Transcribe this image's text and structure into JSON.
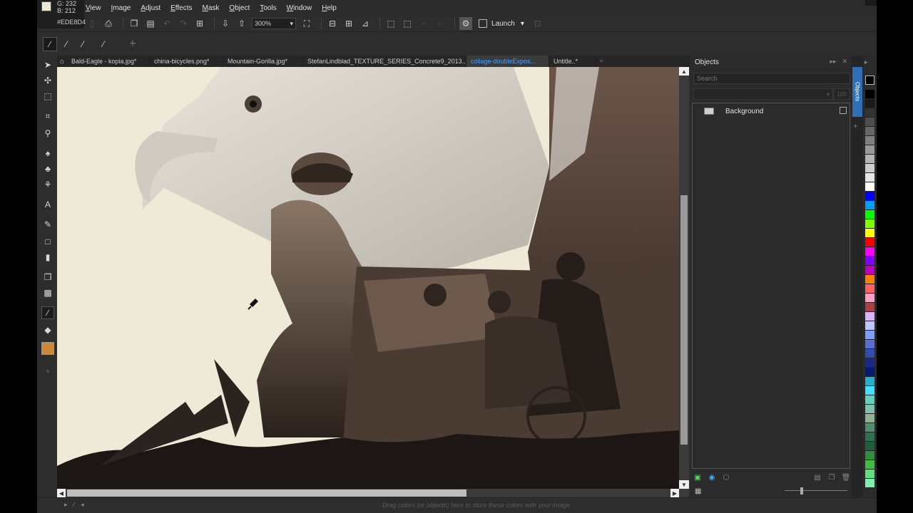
{
  "readout": {
    "g": "G: 232",
    "b": "B: 212",
    "hex": "#EDE8D4"
  },
  "menu": [
    "View",
    "Image",
    "Adjust",
    "Effects",
    "Mask",
    "Object",
    "Tools",
    "Window",
    "Help"
  ],
  "toolbar": {
    "zoom": "300%",
    "launch_label": "Launch"
  },
  "tabs": [
    {
      "label": "Bald-Eagle - kopia.jpg*"
    },
    {
      "label": "china-bicycles.png*"
    },
    {
      "label": "Mountain-Gorilla.jpg*"
    },
    {
      "label": "StefanLindblad_TEXTURE_SERIES_Concrete9_2013...."
    },
    {
      "label": "collage-doubleExpos..."
    },
    {
      "label": "Untitle..*"
    }
  ],
  "objects_panel": {
    "title": "Objects",
    "search_placeholder": "Search",
    "opacity": "100",
    "layers": [
      {
        "name": "Background"
      }
    ],
    "side_tab_label": "Objects"
  },
  "status": {
    "hint": "Drag colors (or objects) here to store these colors with your image"
  },
  "palette_colors": [
    "#000000",
    "#1a1a1a",
    "#333333",
    "#4d4d4d",
    "#666666",
    "#808080",
    "#999999",
    "#b3b3b3",
    "#cccccc",
    "#e6e6e6",
    "#ffffff",
    "#0000ff",
    "#00a0ff",
    "#00ff00",
    "#7fff00",
    "#ffff00",
    "#ff0000",
    "#ff00ff",
    "#8000ff",
    "#c000c0",
    "#ff8000",
    "#ff6060",
    "#ff9ec4",
    "#aa4040",
    "#d8b4ff",
    "#b9c8ff",
    "#7f9fff",
    "#5b6cd8",
    "#304db0",
    "#1b2a8a",
    "#0a1a70",
    "#20b0d0",
    "#40e0ff",
    "#60d0c0",
    "#80c0b0",
    "#90b090",
    "#4f8f6f",
    "#2f6f4f",
    "#1f5f3f",
    "#2f8f3f",
    "#3fbf3f",
    "#5fdf7f",
    "#7fefaf"
  ]
}
